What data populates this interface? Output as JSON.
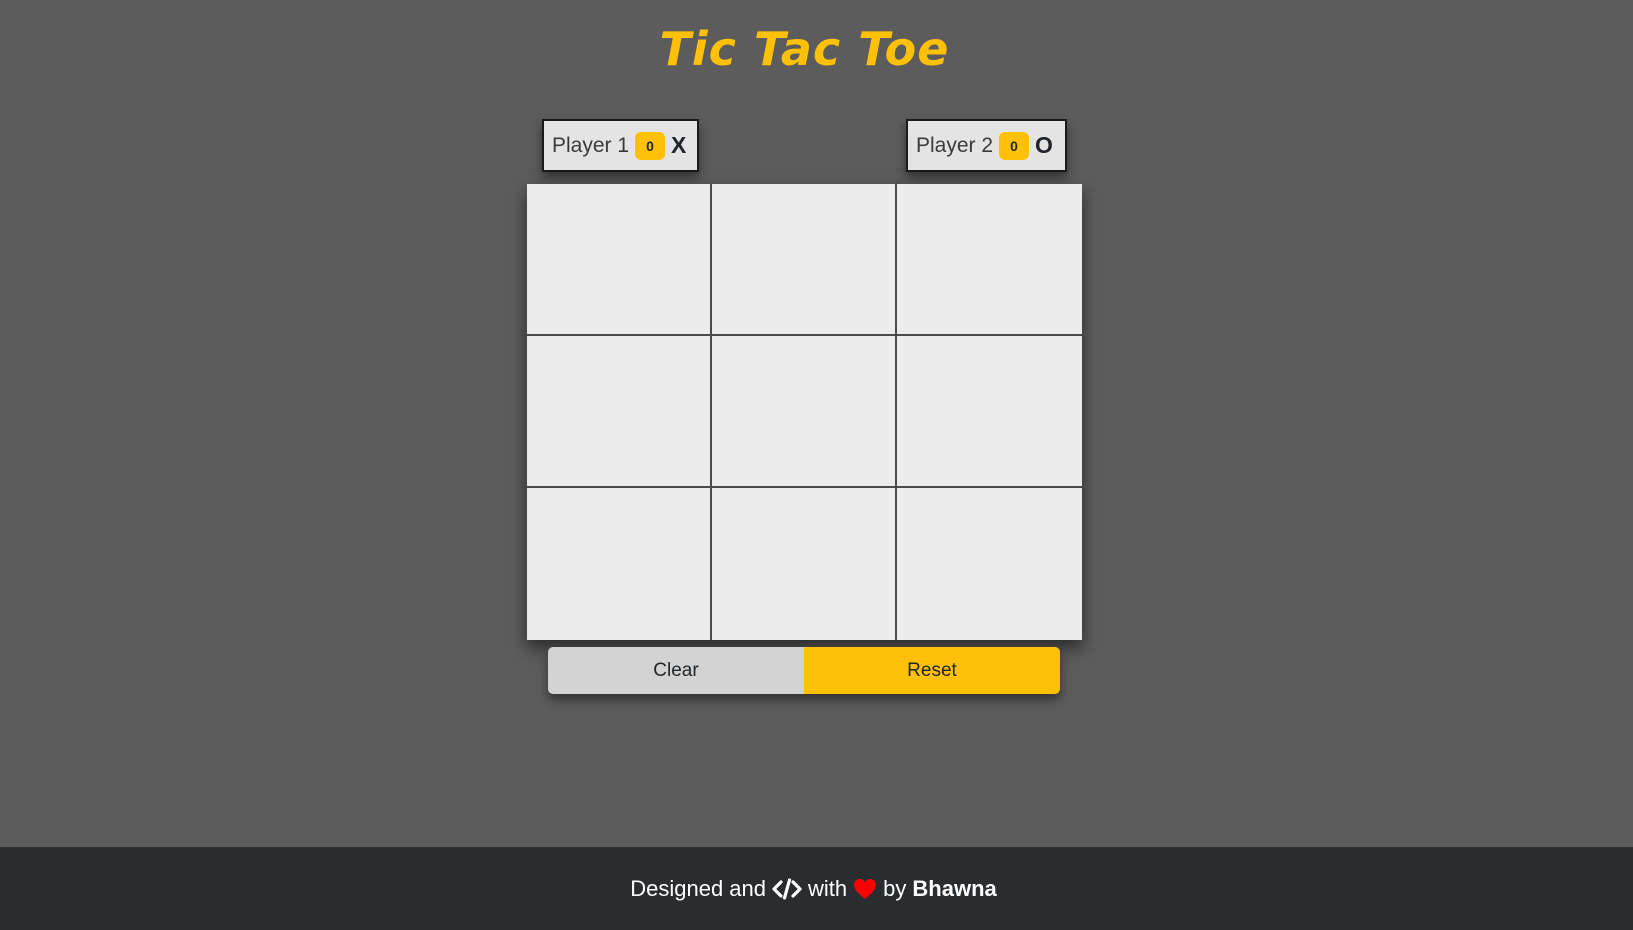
{
  "title": "Tic Tac Toe",
  "players": [
    {
      "name": "Player 1",
      "score": "0",
      "symbol": "X"
    },
    {
      "name": "Player 2",
      "score": "0",
      "symbol": "O"
    }
  ],
  "board": {
    "cells": [
      "",
      "",
      "",
      "",
      "",
      "",
      "",
      "",
      ""
    ]
  },
  "controls": {
    "clear_label": "Clear",
    "reset_label": "Reset"
  },
  "footer": {
    "prefix": "Designed and",
    "code_icon": "code-icon",
    "with": "with",
    "heart_icon": "heart-icon",
    "by": "by",
    "author": "Bhawna"
  },
  "colors": {
    "background": "#5c5c5c",
    "accent": "#ffc107",
    "board": "#ececec",
    "footer": "#292d2f",
    "heart": "#ff0000"
  }
}
